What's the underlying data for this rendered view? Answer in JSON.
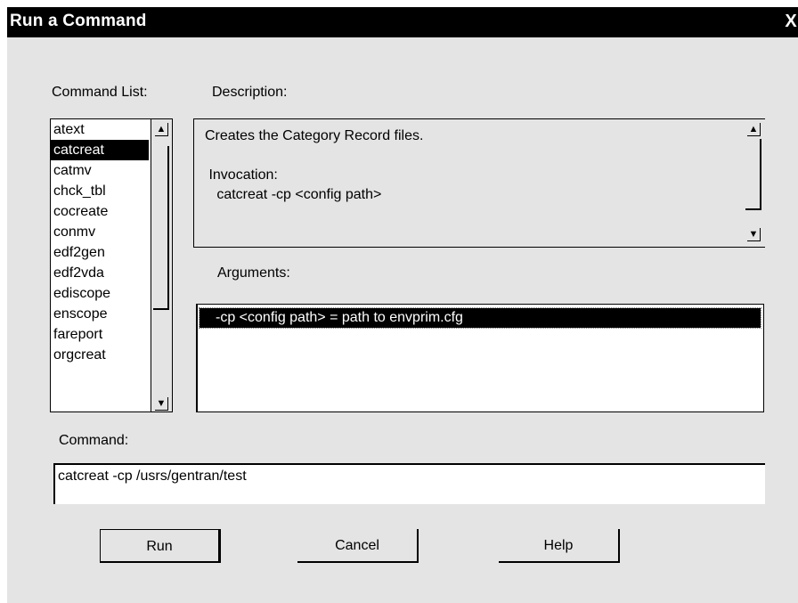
{
  "window": {
    "title": "Run a Command",
    "close_glyph": "X"
  },
  "labels": {
    "command_list": "Command List:",
    "description": "Description:",
    "arguments": "Arguments:",
    "command": "Command:"
  },
  "command_list": {
    "items": [
      "atext",
      "catcreat",
      "catmv",
      "chck_tbl",
      "cocreate",
      "conmv",
      "edf2gen",
      "edf2vda",
      "ediscope",
      "enscope",
      "fareport",
      "orgcreat"
    ],
    "selected": "catcreat"
  },
  "description": {
    "text": "Creates the Category Record files.\n\n Invocation:\n   catcreat -cp <config path>"
  },
  "arguments": {
    "rows": [
      "-cp <config path> = path to envprim.cfg"
    ]
  },
  "command_input": {
    "value": "catcreat -cp /usrs/gentran/test"
  },
  "buttons": {
    "run": "Run",
    "cancel": "Cancel",
    "help": "Help"
  },
  "icons": {
    "scroll_up": "up-arrow-icon",
    "scroll_down": "down-arrow-icon",
    "close": "close-icon"
  }
}
